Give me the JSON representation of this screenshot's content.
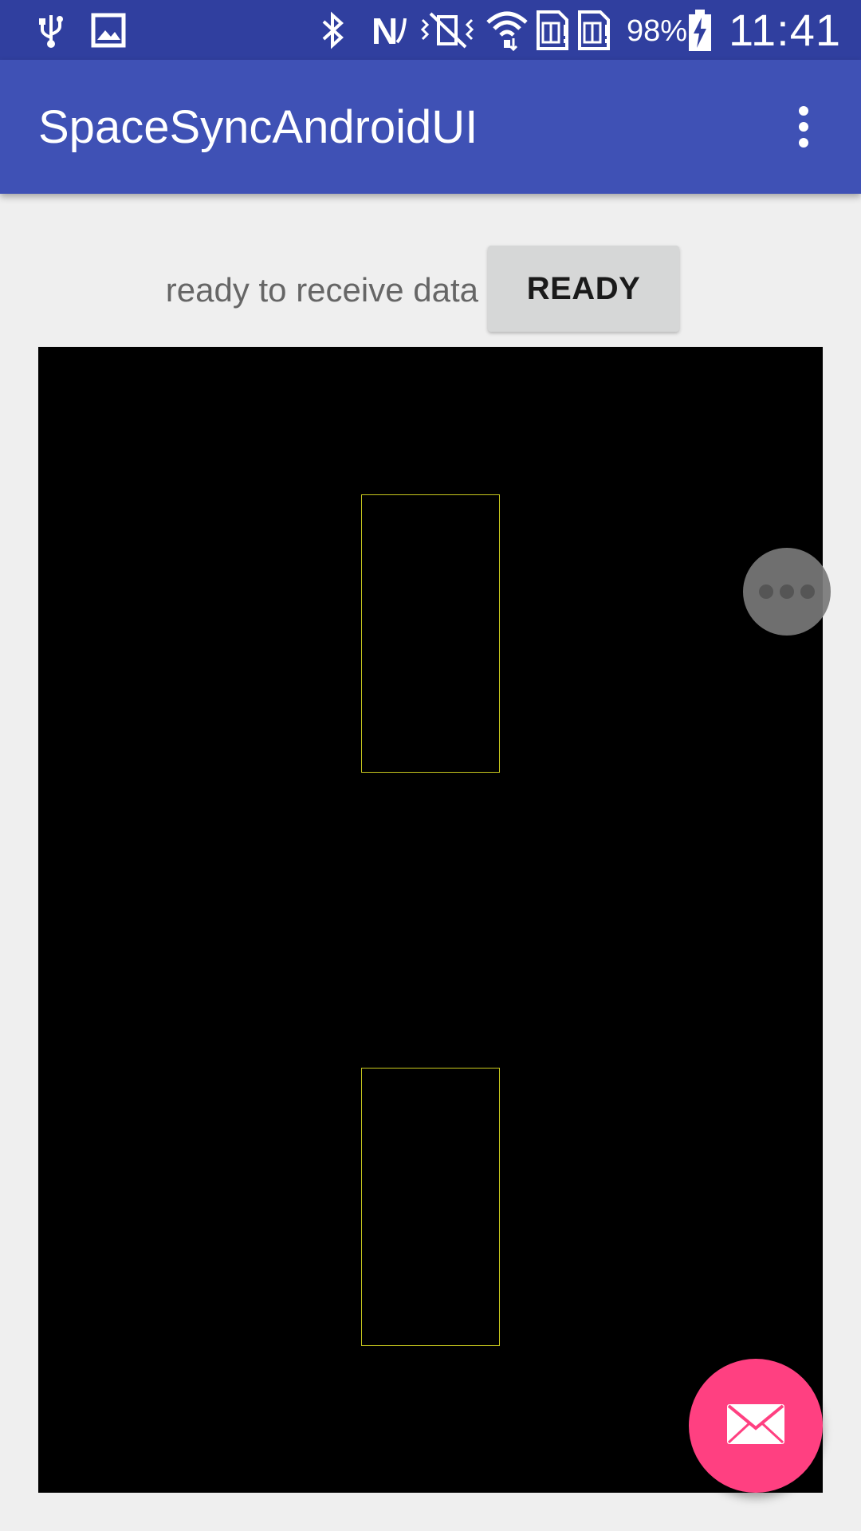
{
  "status_bar": {
    "battery_percent": "98%",
    "time": "11:41",
    "icons": [
      "usb-icon",
      "image-icon",
      "bluetooth-icon",
      "nfc-icon",
      "vibrate-icon",
      "wifi-icon",
      "sim1-icon",
      "sim2-icon",
      "battery-charging-icon"
    ]
  },
  "app_bar": {
    "title": "SpaceSyncAndroidUI",
    "menu_icon": "overflow-menu-icon"
  },
  "main": {
    "status_text": "ready to receive data",
    "ready_button_label": "READY"
  },
  "canvas": {
    "background": "#000000",
    "zone_color": "#c8c81e",
    "zones_count_note": ""
  },
  "floating_handle": {
    "icon": "more-horizontal-icon"
  },
  "fab": {
    "icon": "email-icon",
    "color": "#ff4081"
  },
  "colors": {
    "status_bar": "#303f9f",
    "app_bar": "#3f51b5",
    "page_bg": "#efefef",
    "button_bg": "#d6d7d7"
  }
}
